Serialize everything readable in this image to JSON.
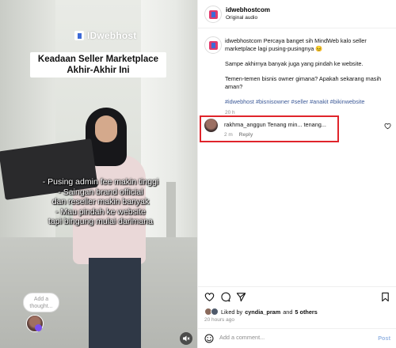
{
  "media": {
    "logo_text": "IDwebhost",
    "title_lines": [
      "Keadaan Seller Marketplace",
      "Akhir-Akhir Ini"
    ],
    "caption_lines": [
      "- Pusing admin fee makin tinggi",
      "- Saingan brand official",
      "dan reseller makin banyak",
      "- Mau pindah ke website",
      "tapi bingung mulai darimana"
    ],
    "thought_placeholder": "Add a thought...",
    "mute_icon": "speaker-muted-icon"
  },
  "header": {
    "username": "idwebhostcom",
    "subtitle": "Original audio"
  },
  "caption": {
    "username": "idwebhostcom",
    "line1": "Percaya banget sih MindWeb kalo seller marketplace lagi pusing-pusingnya 😣",
    "line2": "Sampe akhirnya banyak juga yang pindah ke website.",
    "line3": "Temen-temen bisnis owner gimana? Apakah sekarang masih aman?",
    "hashtags": "#idwebhost #bisnisowner #seller #anakit #bikinwebsite",
    "time": "20 h"
  },
  "reply": {
    "username": "rakhma_anggun",
    "text": "Tenang min... tenang...",
    "time": "2 m",
    "reply_label": "Reply"
  },
  "actions": {
    "liked_prefix": "Liked by",
    "liked_user": "cyndia_pram",
    "liked_mid": "and",
    "liked_others": "5 others",
    "time_ago": "20 hours ago",
    "add_placeholder": "Add a comment...",
    "post_label": "Post"
  },
  "colors": {
    "highlight_border": "#e0242b",
    "hashtag": "#3d5a98",
    "post_button": "#9ab8e4"
  }
}
